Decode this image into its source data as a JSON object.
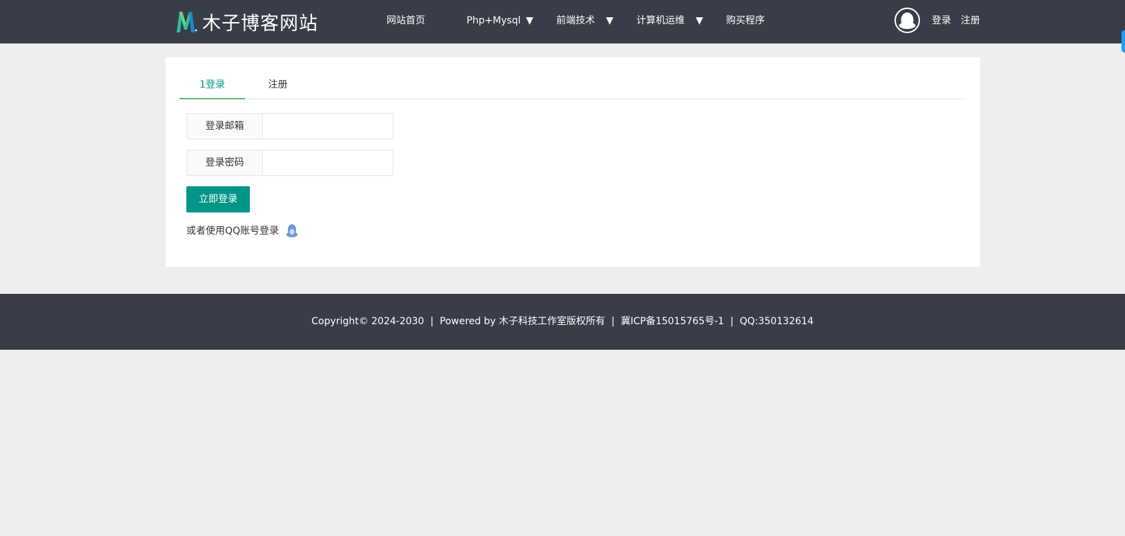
{
  "header": {
    "site_name": "木子博客网站",
    "logo_icon": "m-letter-logo-icon",
    "nav": [
      {
        "label": "网站首页",
        "has_dropdown": false
      },
      {
        "label": "Php+Mysql",
        "has_dropdown": true
      },
      {
        "label": "前端技术",
        "has_dropdown": true
      },
      {
        "label": "计算机运维",
        "has_dropdown": true
      },
      {
        "label": "购买程序",
        "has_dropdown": false
      }
    ],
    "caret": "▼",
    "avatar_icon": "qq-penguin-icon",
    "login_label": "登录",
    "register_label": "注册"
  },
  "tabs": [
    {
      "label": "1登录",
      "active": true
    },
    {
      "label": "注册",
      "active": false
    }
  ],
  "form": {
    "email_label": "登录邮箱",
    "email_value": "",
    "password_label": "登录密码",
    "password_value": "",
    "submit_label": "立即登录",
    "qq_login_text": "或者使用QQ账号登录",
    "qq_icon": "qq-penguin-icon"
  },
  "footer": {
    "copyright": "Copyright© 2024-2030",
    "powered": "Powered by 木子科技工作室版权所有",
    "icp": "冀ICP备15015765号-1",
    "qq": "QQ:350132614",
    "separator": "|"
  },
  "colors": {
    "header_bg": "#393d49",
    "page_bg": "#eeeeee",
    "primary": "#009688",
    "tab_underline": "#5fb878",
    "edge_tab": "#1e9fff"
  }
}
